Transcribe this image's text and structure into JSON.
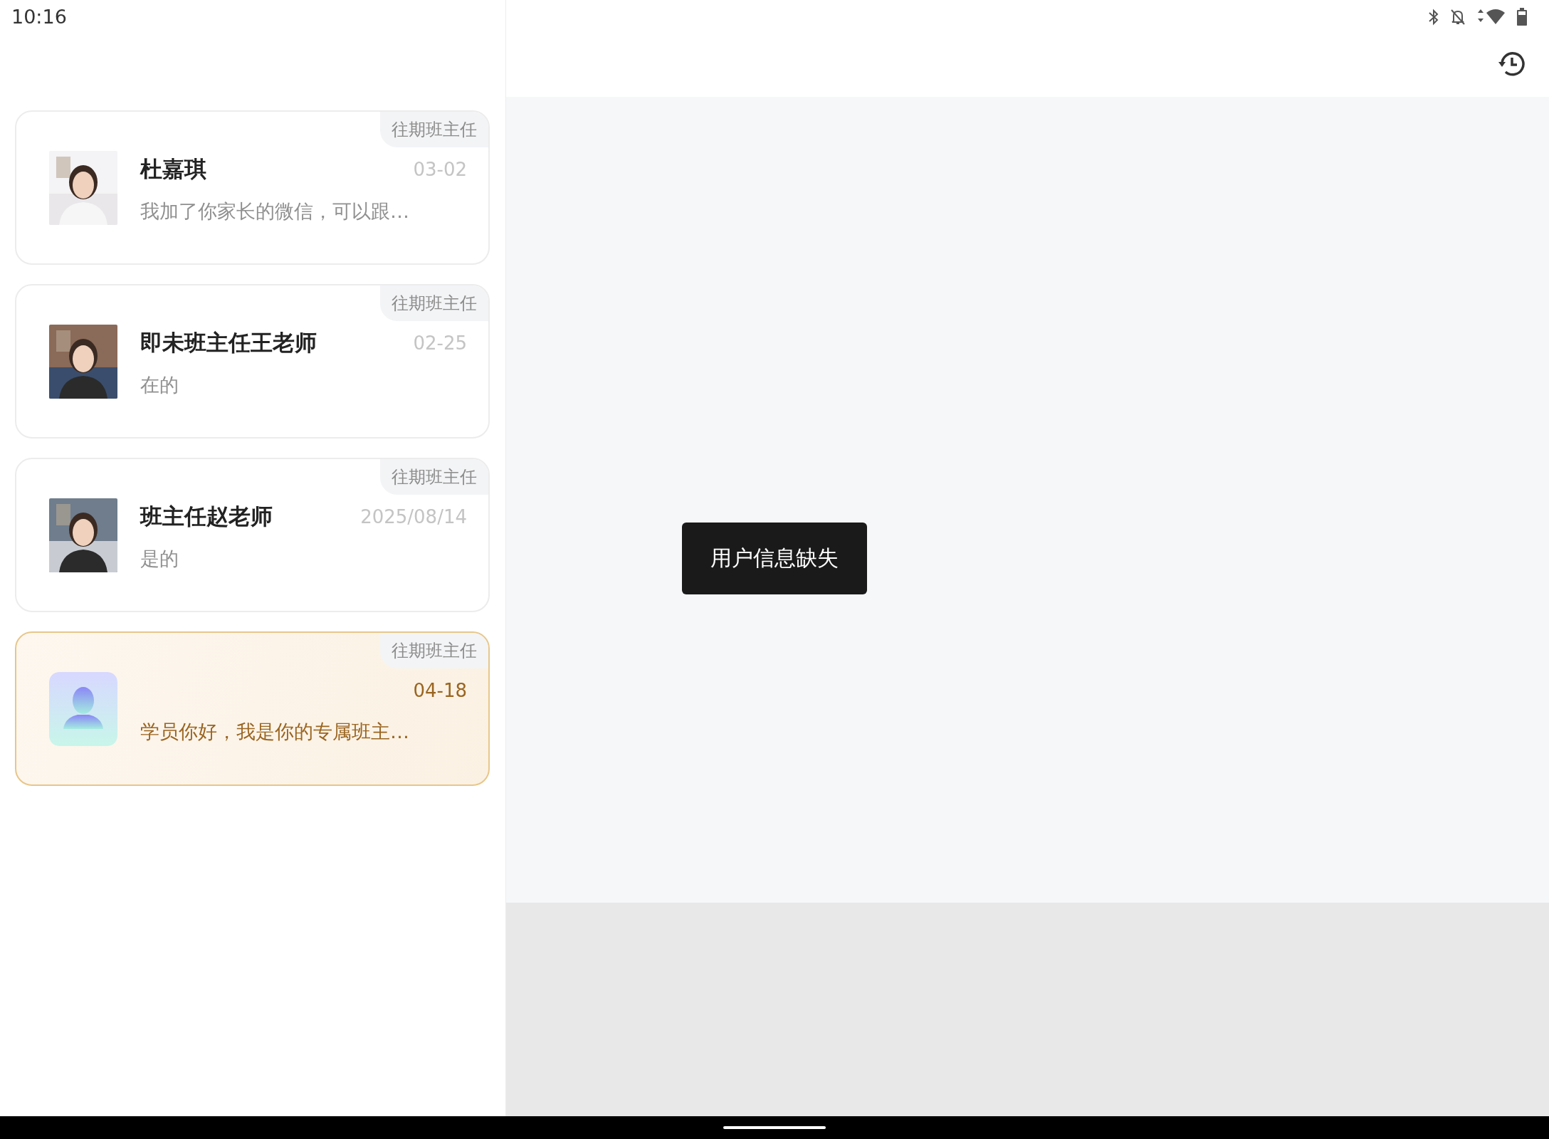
{
  "status_bar": {
    "time": "10:16"
  },
  "conversations": [
    {
      "tag": "往期班主任",
      "name": "杜嘉琪",
      "date": "03-02",
      "message": "我加了你家长的微信，可以跟…",
      "kind": "picture",
      "selected": false
    },
    {
      "tag": "往期班主任",
      "name": "即未班主任王老师",
      "date": "02-25",
      "message": "在的",
      "kind": "picture",
      "selected": false
    },
    {
      "tag": "往期班主任",
      "name": "班主任赵老师",
      "date": "2025/08/14",
      "message": "是的",
      "kind": "picture",
      "selected": false
    },
    {
      "tag": "往期班主任",
      "date": "04-18",
      "message": "学员你好，我是你的专属班主…",
      "kind": "default",
      "selected": true
    }
  ],
  "toast": {
    "text": "用户信息缺失"
  }
}
